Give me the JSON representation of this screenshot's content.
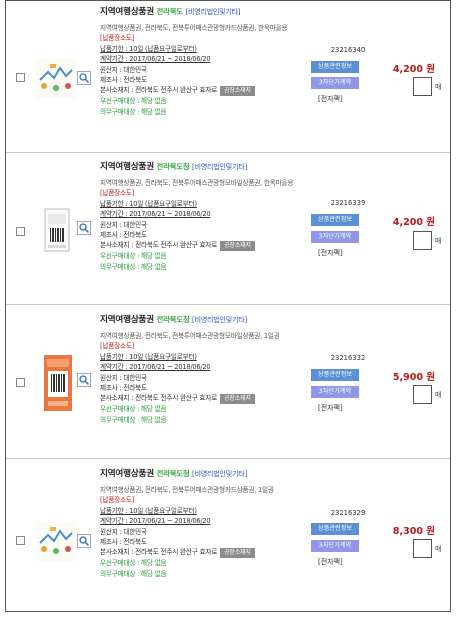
{
  "products": [
    {
      "title": "지역여행상품권",
      "region": "전라북도",
      "category": "[비영리법인및기타]",
      "tags": "지역여행상품권, 전라북도, 전북투어패스관광형카드상품권, 한옥마을용",
      "supply_place": "[납품장소도]",
      "delivery": "납품기한 : 10일 (납품요구일로부터)",
      "contract": "계약기간 : 2017/06/21 ~ 2018/06/20",
      "origin": "원산지 : 대한민국",
      "maker": "제조사 : 전라북도",
      "address": "본사소재지 : 전라북도 전주시 완산구 효자로",
      "factory_button": "공장소재지",
      "priority1": "우선구매대상 : 해당 없음",
      "priority2": "의무구매대상 : 해당 없음",
      "code": "23216340",
      "info_button": "상품관련정보",
      "contract_button": "3자단가계약",
      "form": "[전자팩]",
      "price": "4,200 원",
      "unit": "매"
    },
    {
      "title": "지역여행상품권",
      "region": "전라북도청",
      "category": "[비영리법인및기타]",
      "tags": "지역여행상품권, 전라북도, 전북투어패스관광형모바일상품권, 한옥마을용",
      "supply_place": "[납품장소도]",
      "delivery": "납품기한 : 10일 (납품요구일로부터)",
      "contract": "계약기간 : 2017/06/21 ~ 2018/06/20",
      "origin": "원산지 : 대한민국",
      "maker": "제조사 : 전라북도",
      "address": "본사소재지 : 전라북도 전주시 완산구 효자로",
      "factory_button": "공장소재지",
      "priority1": "우선구매대상 : 해당 없음",
      "priority2": "의무구매대상 : 해당 없음",
      "code": "23216339",
      "info_button": "상품관련정보",
      "contract_button": "3자단가계약",
      "form": "[전자팩]",
      "price": "4,200 원",
      "unit": "매"
    },
    {
      "title": "지역여행상품권",
      "region": "전라북도청",
      "category": "[비영리법인및기타]",
      "tags": "지역여행상품권, 전라북도, 전북투어패스관광형모바일상품권, 1일권",
      "supply_place": "[납품장소도]",
      "delivery": "납품기한 : 10일 (납품요구일로부터)",
      "contract": "계약기간 : 2017/06/21 ~ 2018/06/20",
      "origin": "원산지 : 대한민국",
      "maker": "제조사 : 전라북도",
      "address": "본사소재지 : 전라북도 전주시 완산구 효자로",
      "factory_button": "공장소재지",
      "priority1": "우선구매대상 : 해당 없음",
      "priority2": "의무구매대상 : 해당 없음",
      "code": "23216332",
      "info_button": "상품관련정보",
      "contract_button": "3자단가계약",
      "form": "[전자팩]",
      "price": "5,900 원",
      "unit": "매"
    },
    {
      "title": "지역여행상품권",
      "region": "전라북도청",
      "category": "[비영리법인및기타]",
      "tags": "지역여행상품권, 전라북도, 전북투어패스관광형카드상품권, 1일권",
      "supply_place": "[납품장소도]",
      "delivery": "납품기한 : 10일 (납품요구일로부터)",
      "contract": "계약기간 : 2017/06/21 ~ 2018/06/20",
      "origin": "원산지 : 대한민국",
      "maker": "제조사 : 전라북도",
      "address": "본사소재지 : 전라북도 전주시 완산구 효자로",
      "factory_button": "공장소재지",
      "priority1": "우선구매대상 : 해당 없음",
      "priority2": "의무구매대상 : 해당 없음",
      "code": "23216329",
      "info_button": "상품관련정보",
      "contract_button": "3자단가계약",
      "form": "[전자팩]",
      "price": "8,300 원",
      "unit": "매"
    }
  ]
}
